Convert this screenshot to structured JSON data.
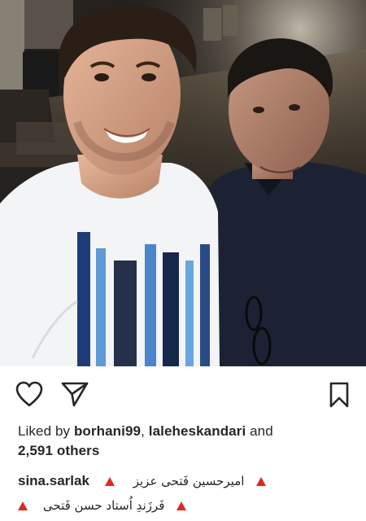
{
  "post": {
    "image": {
      "description_icon": "selfie-photo"
    },
    "actions": {
      "like_icon": "heart-outline-icon",
      "share_icon": "paper-plane-icon",
      "save_icon": "bookmark-outline-icon"
    },
    "likes": {
      "prefix": "Liked by ",
      "user1": "borhani99",
      "separator": ", ",
      "user2": "laleheskandari",
      "and": " and",
      "others": "2,591 others"
    },
    "caption": {
      "username": "sina.sarlak",
      "line1_text": "امیرحسین فَتحی عزیز",
      "line2_text": "فَرزَندِ اُستاد حسن فَتحی"
    }
  },
  "colors": {
    "text": "#262626",
    "warning": "#e0281f",
    "background": "#ffffff"
  }
}
